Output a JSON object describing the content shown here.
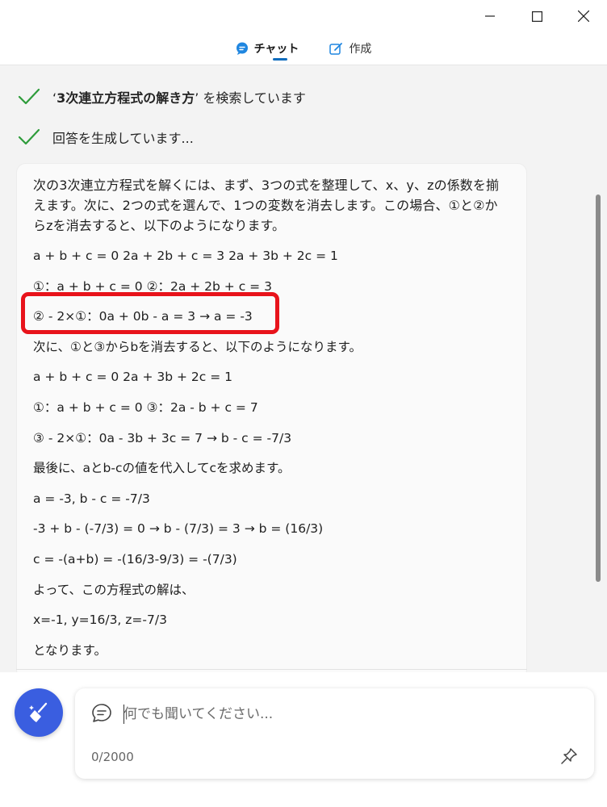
{
  "window": {
    "controls": [
      "minimize",
      "maximize",
      "close"
    ]
  },
  "tabs": [
    {
      "label": "チャット",
      "icon": "chat-bubble-icon",
      "active": true
    },
    {
      "label": "作成",
      "icon": "compose-icon",
      "active": false
    }
  ],
  "status": [
    {
      "icon": "checkmark-icon",
      "prefix": "‘",
      "query": "3次連立方程式の解き方",
      "suffix": "’ を検索しています"
    },
    {
      "icon": "checkmark-icon",
      "text": "回答を生成しています..."
    }
  ],
  "answer": {
    "intro": "次の3次連立方程式を解くには、まず、3つの式を整理して、x、y、zの係数を揃えます。次に、2つの式を選んで、1つの変数を消去します。この場合、①と②からzを消去すると、以下のようになります。",
    "lines": [
      "a + b + c = 0 2a + 2b + c = 3 2a + 3b + 2c = 1",
      "①：a + b + c = 0 ②：2a + 2b + c = 3",
      "② - 2×①：0a + 0b - a = 3 → a = -3",
      "次に、①と③からbを消去すると、以下のようになります。",
      "a + b + c = 0 2a + 3b + 2c = 1",
      "①：a + b + c = 0 ③：2a - b + c = 7",
      "③ - 2×①：0a - 3b + 3c = 7 → b - c = -7/3",
      "最後に、aとb-cの値を代入してcを求めます。",
      "a = -3, b - c = -7/3",
      "-3 + b - (-7/3) = 0 → b - (7/3) = 3 → b = (16/3)",
      "c = -(a+b) = -(16/3-9/3) = -(7/3)",
      "よって、この方程式の解は、",
      "x=-1, y=16/3, z=-7/3",
      "となります。"
    ]
  },
  "composer": {
    "placeholder": "何でも聞いてください...",
    "counter": "0/2000"
  },
  "colors": {
    "accent": "#0f6cbd",
    "check": "#2e9c3b",
    "highlight": "#e8131b",
    "new_topic": "#3a5ee0"
  }
}
